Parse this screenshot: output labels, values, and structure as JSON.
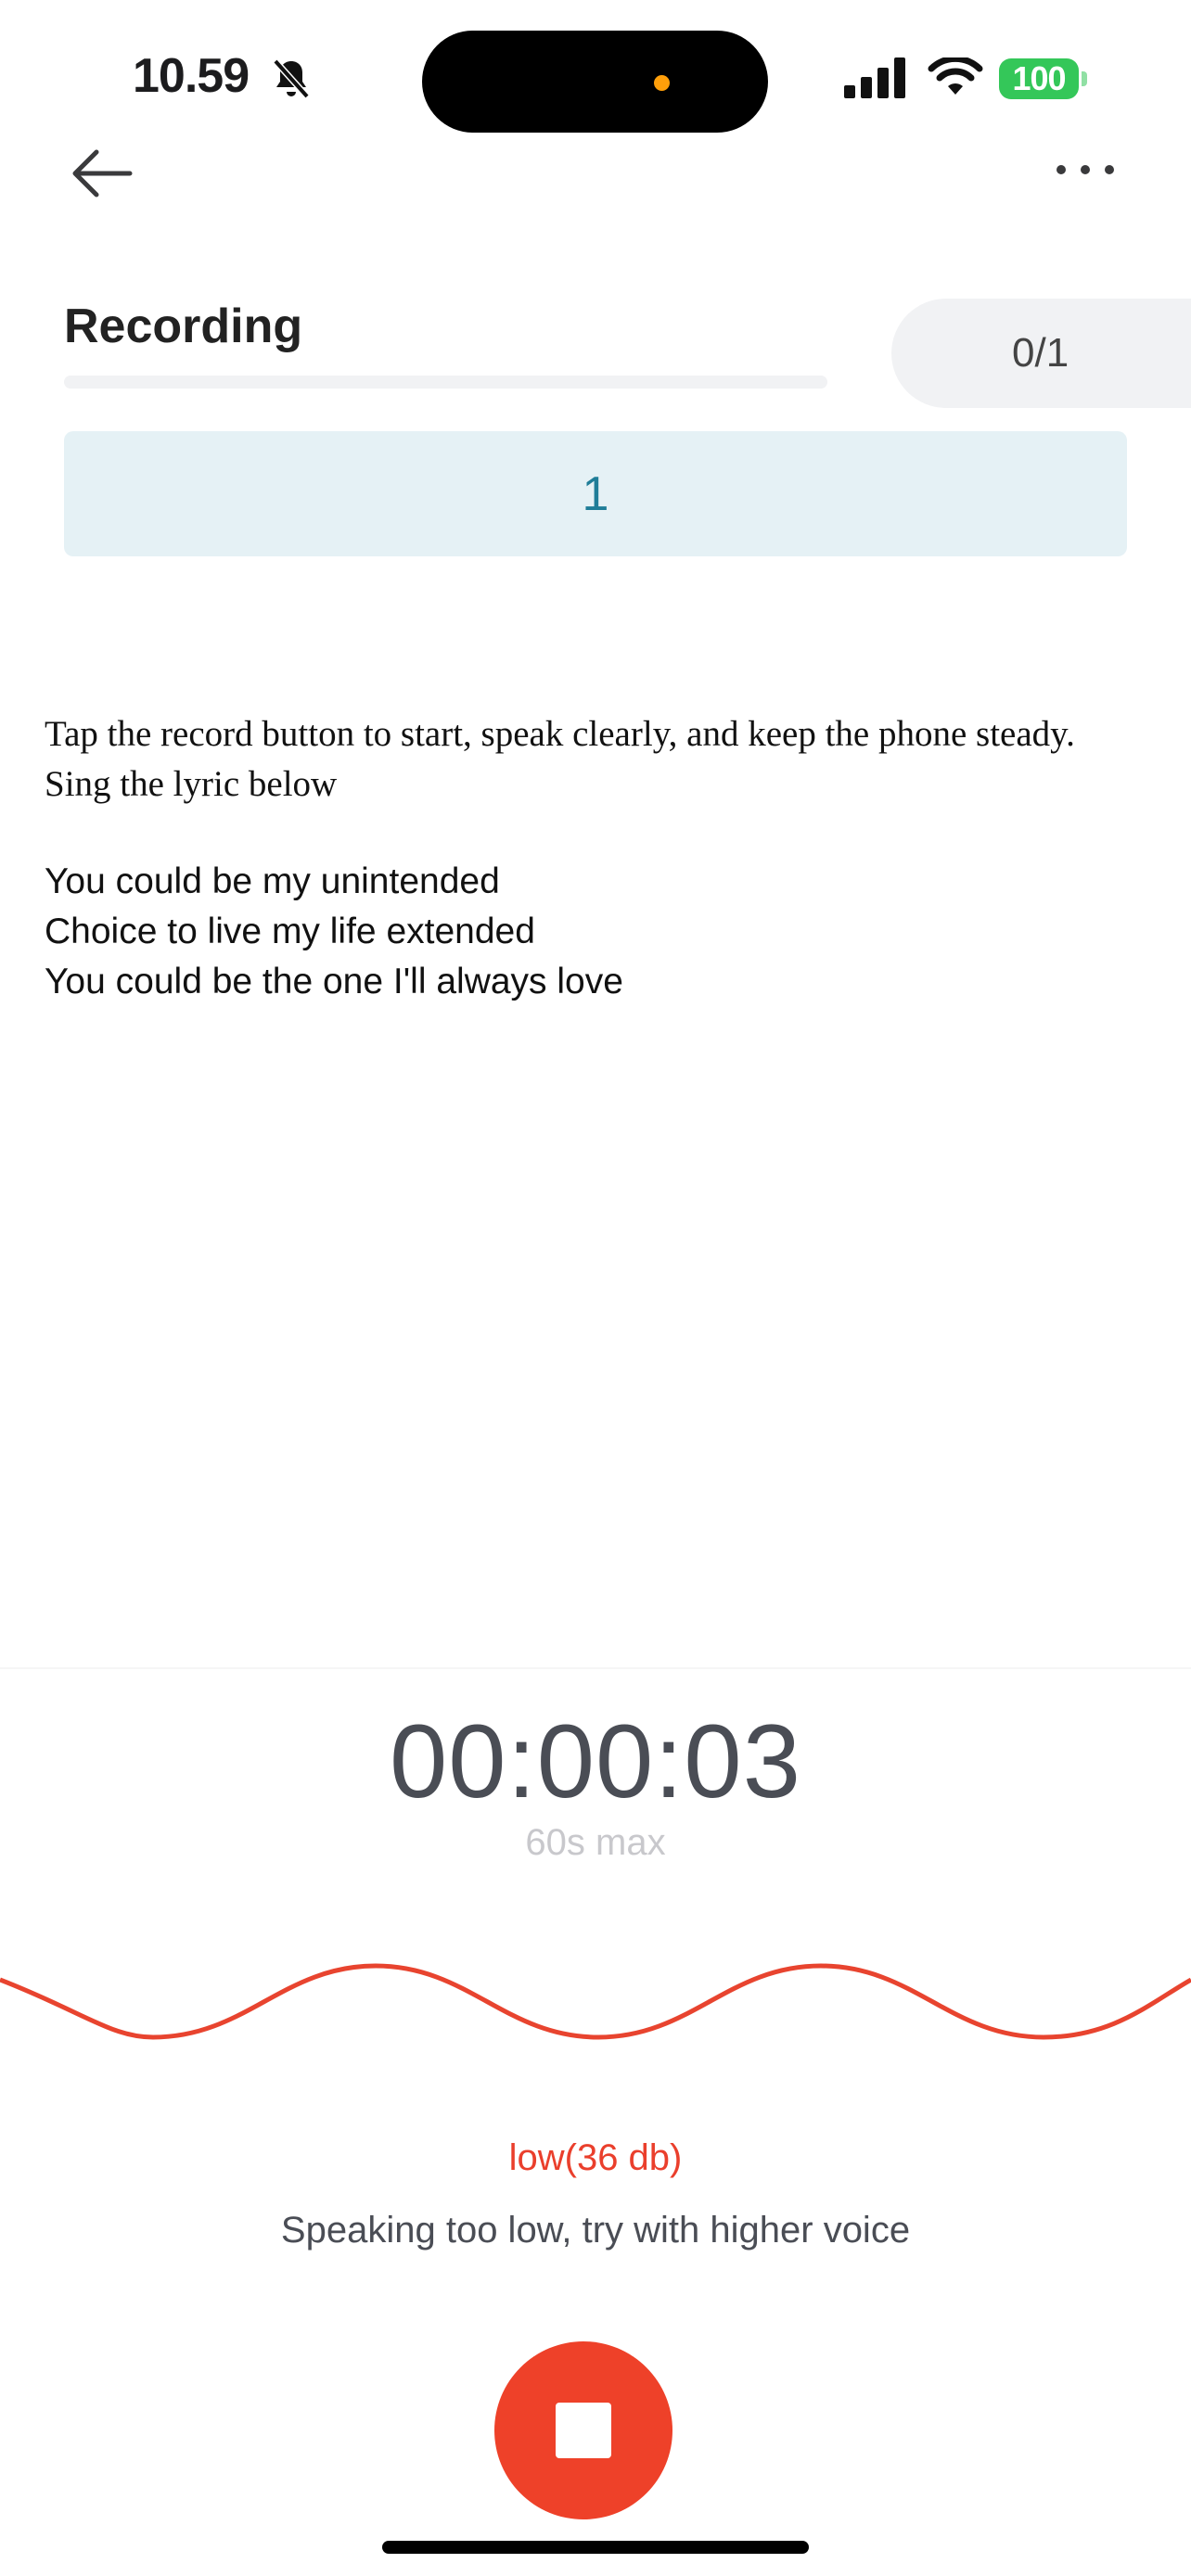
{
  "status_bar": {
    "time": "10.59",
    "battery": "100"
  },
  "page": {
    "title": "Recording",
    "count": "0/1",
    "progress": 0,
    "step": "1"
  },
  "instructions": {
    "line1": "Tap the record button to start, speak clearly, and keep the phone steady.",
    "line2": "Sing the lyric below"
  },
  "lyrics": [
    "You could be my unintended",
    "Choice to live my life extended",
    "You could be the one I'll always love"
  ],
  "recorder": {
    "timer": "00:00:03",
    "max_label": "60s max",
    "level": "low(36 db)",
    "hint": "Speaking too low, try with higher voice"
  },
  "icons": {
    "back": "arrow-left-icon",
    "more": "more-dots-icon",
    "stop": "stop-icon",
    "bell_muted": "bell-slash-icon"
  },
  "colors": {
    "accent_red": "#ee4129",
    "step_bg": "#e5f1f5",
    "step_text": "#1f7d98",
    "battery_green": "#34c759"
  }
}
